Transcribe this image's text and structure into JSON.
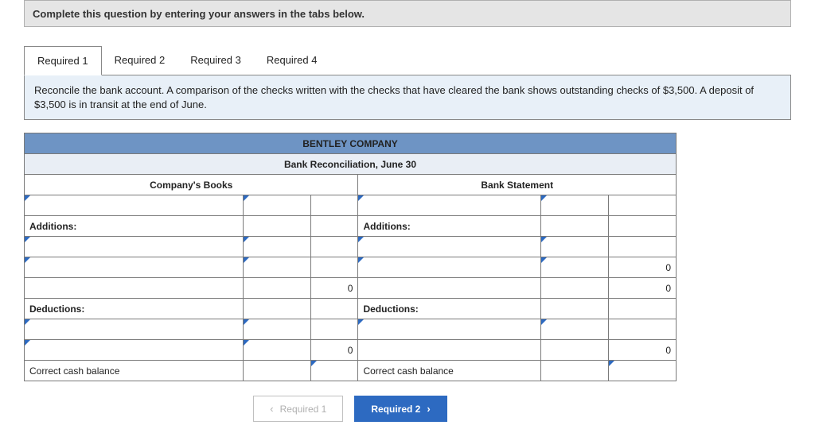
{
  "top_banner_text": "Complete this question by entering your answers in the tabs below.",
  "tabs": [
    "Required 1",
    "Required 2",
    "Required 3",
    "Required 4"
  ],
  "active_tab_index": 0,
  "instructions": "Reconcile the bank account. A comparison of the checks written with the checks that have cleared the bank shows outstanding checks of $3,500. A deposit of $3,500 is in transit at the end of June.",
  "company_title": "BENTLEY COMPANY",
  "statement_title": "Bank Reconciliation, June 30",
  "left_header": "Company's Books",
  "right_header": "Bank Statement",
  "row_labels": {
    "additions": "Additions:",
    "deductions": "Deductions:",
    "correct_balance": "Correct cash balance"
  },
  "values": {
    "left_additions_total": "0",
    "right_zero_a": "0",
    "right_zero_b": "0",
    "left_deductions_total": "0",
    "right_deductions_total": "0"
  },
  "nav": {
    "prev": "Required 1",
    "next": "Required 2"
  }
}
